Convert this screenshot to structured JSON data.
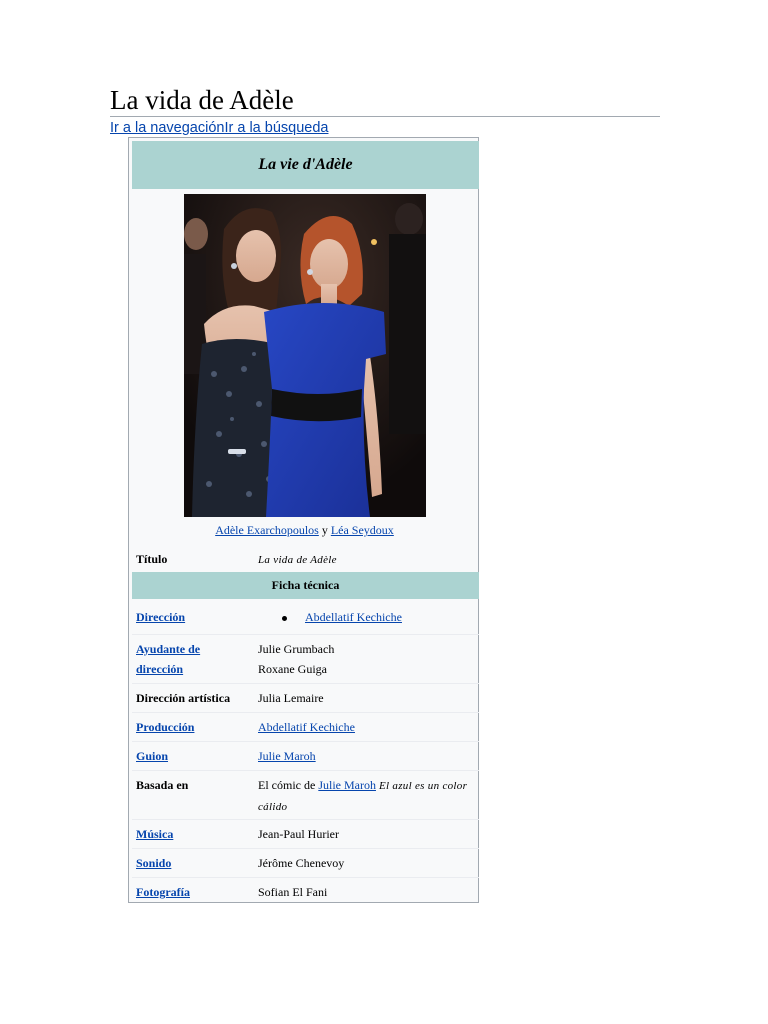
{
  "page": {
    "title": "La vida de Adèle",
    "jump_navigation": "Ir a la navegación",
    "jump_search": "Ir a la búsqueda"
  },
  "infobox": {
    "heading": "La vie d'Adèle",
    "caption": {
      "person1": "Adèle Exarchopoulos",
      "conjunction": " y ",
      "person2": "Léa Seydoux"
    },
    "title_row": {
      "label": "Título",
      "value": "La vida de Adèle"
    },
    "section_heading": "Ficha técnica",
    "rows": [
      {
        "label": "Dirección",
        "values": [
          "Abdellatif Kechiche"
        ]
      },
      {
        "label": "Ayudante de dirección",
        "values": [
          "Julie Grumbach",
          "Roxane Guiga"
        ]
      },
      {
        "label": "Dirección artística",
        "values": [
          "Julia Lemaire"
        ]
      },
      {
        "label": "Producción",
        "values": [
          "Abdellatif Kechiche"
        ]
      },
      {
        "label": "Guion",
        "values": [
          "Julie Maroh"
        ]
      },
      {
        "label": "Basada en",
        "prefix": "El cómic de ",
        "link": "Julie Maroh",
        "work": "El azul es un color cálido"
      },
      {
        "label": "Música",
        "values": [
          "Jean-Paul Hurier"
        ]
      },
      {
        "label": "Sonido",
        "values": [
          "Jérôme Chenevoy"
        ]
      },
      {
        "label": "Fotografía",
        "values": [
          "Sofian El Fani"
        ]
      }
    ]
  },
  "colors": {
    "link": "#0645ad",
    "header_bg": "#abd3d1",
    "infobox_bg": "#f8f9fa",
    "border": "#a2a9b1"
  }
}
